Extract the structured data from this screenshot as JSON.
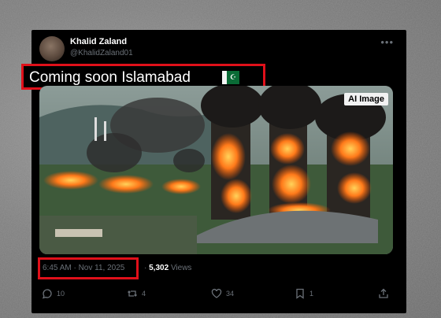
{
  "post": {
    "author_name": "Khalid Zaland",
    "author_handle": "@KhalidZaland01",
    "text": "Coming soon Islamabad",
    "media_badge": "AI Image",
    "timestamp": "6:45 AM · Nov 11, 2025",
    "separator": "·",
    "views_count": "5,302",
    "views_label": "Views"
  },
  "actions": {
    "replies": "10",
    "reposts": "4",
    "likes": "34",
    "bookmarks": "1"
  },
  "colors": {
    "highlight_border": "#e0101a",
    "card_bg": "#000000",
    "muted_text": "#6b7178"
  },
  "icons": [
    "more-icon",
    "pakistan-flag-icon",
    "reply-icon",
    "repost-icon",
    "like-icon",
    "bookmark-icon",
    "share-icon"
  ]
}
